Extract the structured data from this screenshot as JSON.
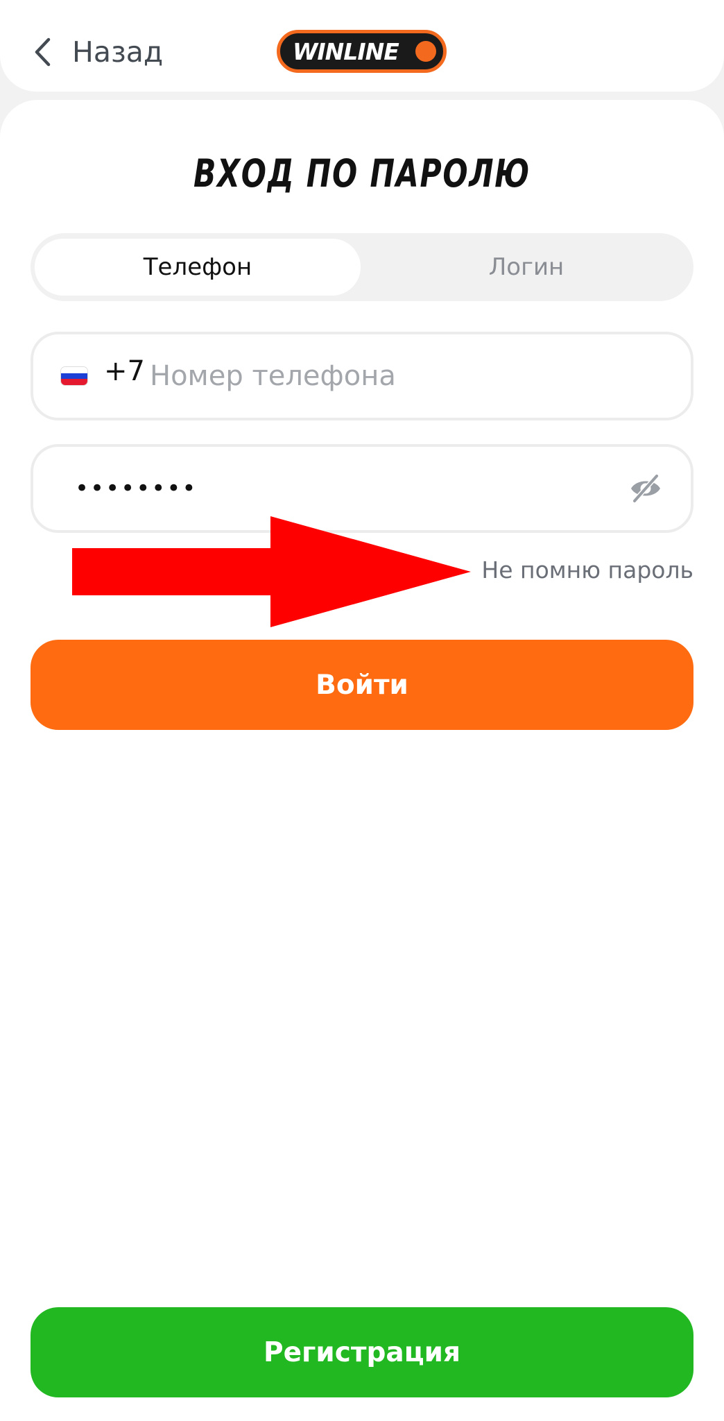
{
  "header": {
    "back_label": "Назад",
    "back_icon": "chevron-left-icon",
    "logo_text": "WINLINE"
  },
  "title": "ВХОД ПО ПАРОЛЮ",
  "tabs": [
    {
      "label": "Телефон",
      "active": true
    },
    {
      "label": "Логин",
      "active": false
    }
  ],
  "phone": {
    "flag_icon": "russia-flag-icon",
    "country_code": "+7",
    "placeholder": "Номер телефона",
    "value": ""
  },
  "password": {
    "value": "••••••••",
    "toggle_icon": "eye-off-icon"
  },
  "forgot_label": "Не помню пароль",
  "login_label": "Войти",
  "register_label": "Регистрация",
  "colors": {
    "brand_orange": "#fe6b10",
    "register_green": "#21b821",
    "annotation_arrow": "#ff0000",
    "flag_white": "#ffffff",
    "flag_blue": "#1c3fd6",
    "flag_red": "#e4192f"
  }
}
